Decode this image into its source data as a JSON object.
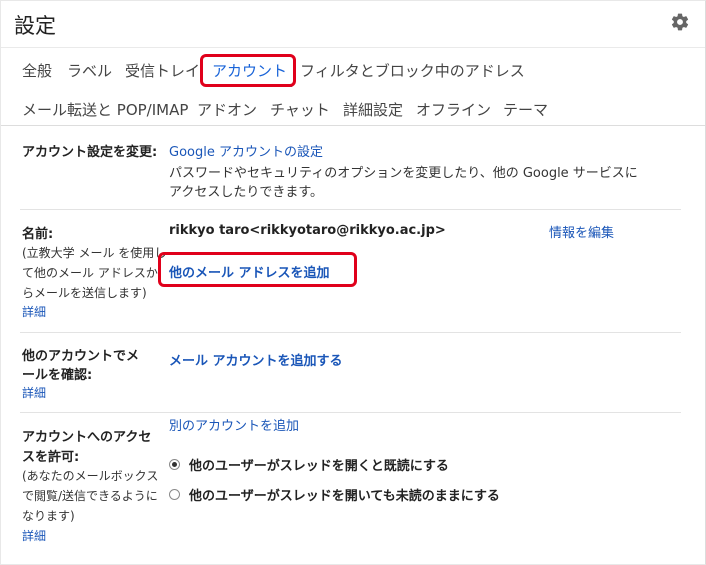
{
  "header": {
    "title": "設定",
    "settings_icon": "gear-icon"
  },
  "tabs_row1": [
    {
      "label": "全般",
      "active": false
    },
    {
      "label": "ラベル",
      "active": false
    },
    {
      "label": "受信トレイ",
      "active": false
    },
    {
      "label": "アカウント",
      "active": true
    },
    {
      "label": "フィルタとブロック中のアドレス",
      "active": false
    }
  ],
  "tabs_row2": [
    {
      "label": "メール転送と POP/IMAP"
    },
    {
      "label": "アドオン"
    },
    {
      "label": "チャット"
    },
    {
      "label": "詳細設定"
    },
    {
      "label": "オフライン"
    },
    {
      "label": "テーマ"
    }
  ],
  "colors": {
    "link": "#1a56b8",
    "active_tab": "#1a64d8",
    "highlight_box": "#e0001b"
  },
  "sections": {
    "change_account": {
      "label": "アカウント設定を変更:",
      "link": "Google アカウントの設定",
      "desc_line1": "パスワードやセキュリティのオプションを変更したり、他の Google サービスに",
      "desc_line2": "アクセスしたりできます。"
    },
    "name": {
      "label": "名前:",
      "note_lines": [
        "(立教大学 メール を使用し",
        "て他のメール アドレスか",
        "らメールを送信します)"
      ],
      "detail": "詳細",
      "value": "rikkyo taro<rikkyotaro@rikkyo.ac.jp>",
      "edit_link": "情報を編集",
      "add_address_link": "他のメール アドレスを追加"
    },
    "check_mail": {
      "label_lines": [
        "他のアカウントでメ",
        "ールを確認:"
      ],
      "detail": "詳細",
      "add_account_link": "メール アカウントを追加する"
    },
    "grant_access": {
      "label_lines": [
        "アカウントへのアクセ",
        "スを許可:"
      ],
      "note_lines": [
        "(あなたのメールボックス",
        "で閲覧/送信できるように",
        "なります)"
      ],
      "detail": "詳細",
      "add_other_link": "別のアカウントを追加",
      "options": [
        {
          "label": "他のユーザーがスレッドを開くと既読にする",
          "selected": true
        },
        {
          "label": "他のユーザーがスレッドを開いても未読のままにする",
          "selected": false
        }
      ]
    }
  }
}
